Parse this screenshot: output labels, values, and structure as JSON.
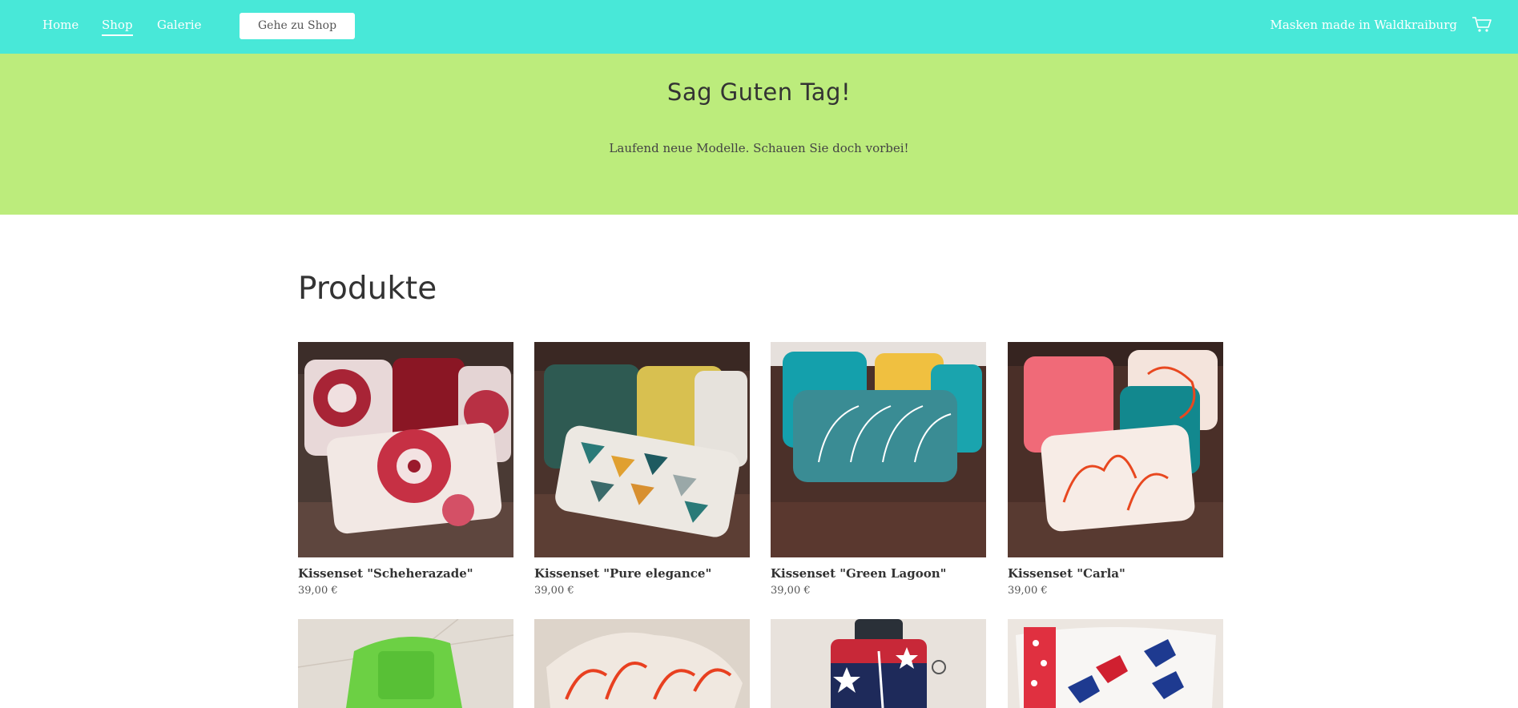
{
  "nav": {
    "items": [
      {
        "label": "Home"
      },
      {
        "label": "Shop"
      },
      {
        "label": "Galerie"
      }
    ],
    "cta": "Gehe zu Shop",
    "brand": "Masken made in Waldkraiburg",
    "cart_icon": "cart-icon"
  },
  "hero": {
    "title": "Sag Guten Tag!",
    "subtitle": "Laufend neue Modelle. Schauen Sie doch vorbei!"
  },
  "products": {
    "title": "Produkte",
    "items": [
      {
        "name": "Kissenset \"Scheherazade\"",
        "price": "39,00 €"
      },
      {
        "name": "Kissenset \"Pure elegance\"",
        "price": "39,00 €"
      },
      {
        "name": "Kissenset \"Green Lagoon\"",
        "price": "39,00 €"
      },
      {
        "name": "Kissenset \"Carla\"",
        "price": "39,00 €"
      },
      {
        "name": "",
        "price": ""
      },
      {
        "name": "",
        "price": ""
      },
      {
        "name": "",
        "price": ""
      },
      {
        "name": "",
        "price": ""
      }
    ]
  },
  "colors": {
    "topbar": "#48e8d8",
    "hero": "#bcec7c"
  }
}
